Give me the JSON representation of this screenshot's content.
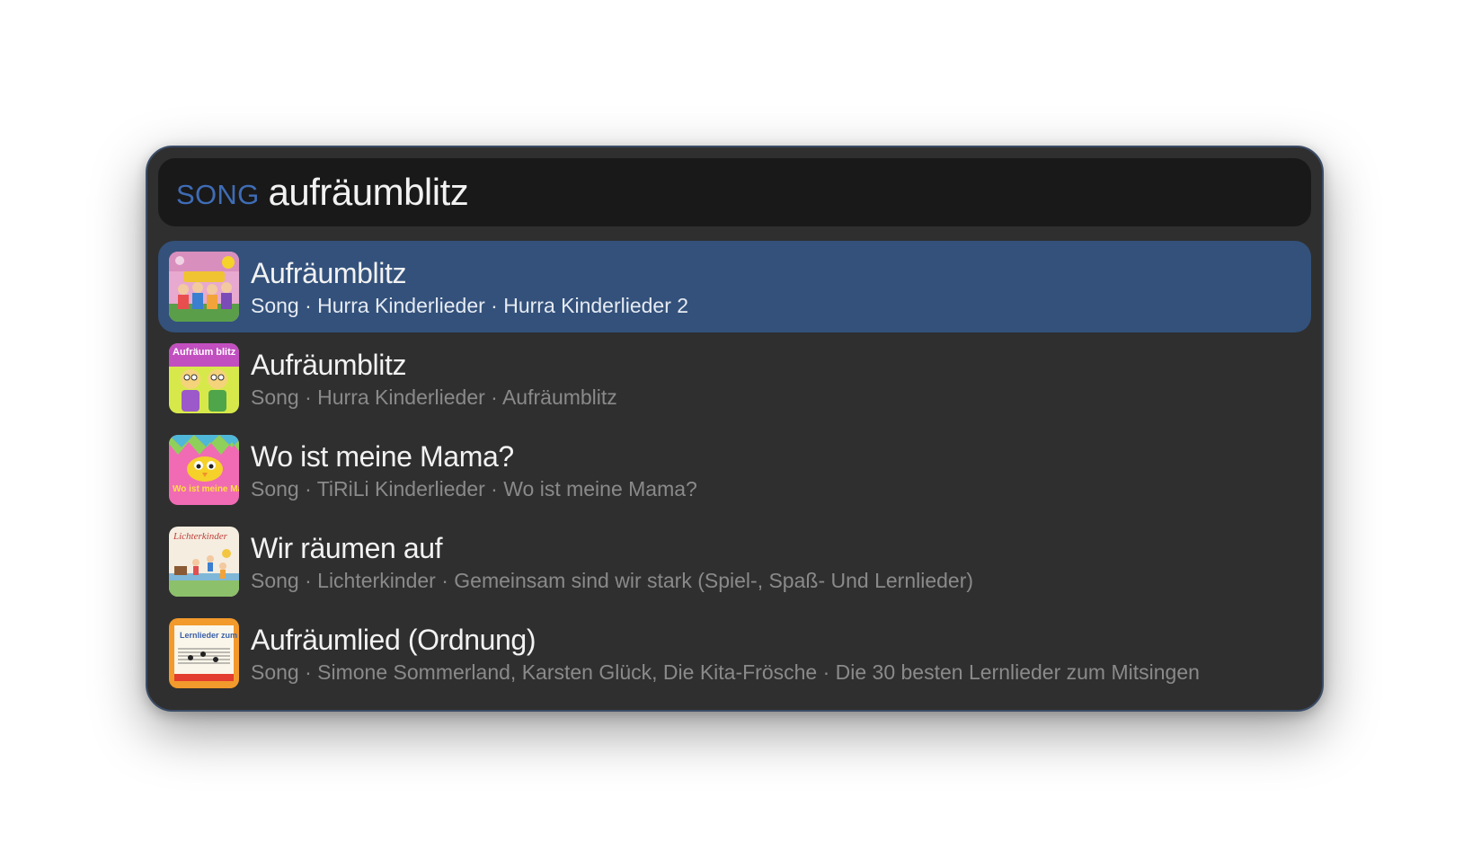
{
  "search": {
    "type_label": "SONG",
    "query": "aufräumblitz"
  },
  "results": [
    {
      "title": "Aufräumblitz",
      "subtitle": "Song · Hurra Kinderlieder · Hurra Kinderlieder 2",
      "artwork_icon": "album-art-hurra-kinderlieder-2",
      "selected": true
    },
    {
      "title": "Aufräumblitz",
      "subtitle": "Song · Hurra Kinderlieder · Aufräumblitz",
      "artwork_icon": "album-art-aufraeumblitz",
      "artwork_text": "Aufräum blitz",
      "selected": false
    },
    {
      "title": "Wo ist meine Mama?",
      "subtitle": "Song · TiRiLi Kinderlieder · Wo ist meine Mama?",
      "artwork_icon": "album-art-wo-ist-meine-mama",
      "artwork_text": "Wo ist meine Mama?",
      "selected": false
    },
    {
      "title": "Wir räumen auf",
      "subtitle": "Song · Lichterkinder · Gemeinsam sind wir stark (Spiel-, Spaß- Und Lernlieder)",
      "artwork_icon": "album-art-lichterkinder",
      "artwork_text": "Lichterkinder",
      "selected": false
    },
    {
      "title": "Aufräumlied (Ordnung)",
      "subtitle": "Song · Simone Sommerland, Karsten Glück, Die Kita-Frösche · Die 30 besten Lernlieder zum Mitsingen",
      "artwork_icon": "album-art-lernlieder",
      "artwork_text": "Lernlieder zum Mitsingen",
      "selected": false
    }
  ],
  "colors": {
    "panel_bg": "#2f2f2f",
    "search_bg": "#191919",
    "selected_row": "#33517b",
    "type_label": "#3f6cb5",
    "title_text": "#f2f2f2",
    "subtitle_text": "#8a8a8a"
  }
}
